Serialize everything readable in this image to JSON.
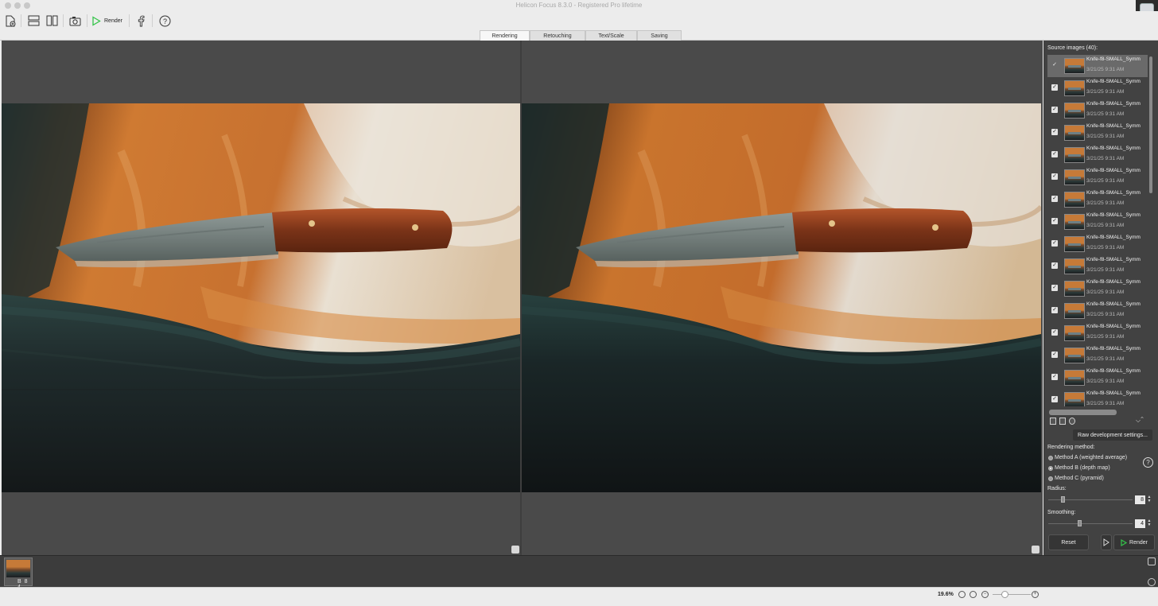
{
  "window": {
    "title": "Helicon Focus 8.3.0 - Registered Pro lifetime"
  },
  "toolbar": {
    "render_label": "Render",
    "icons": [
      "new-file-icon",
      "layout-horizontal-icon",
      "layout-vertical-icon",
      "camera-icon",
      "play-icon",
      "facebook-icon",
      "help-icon"
    ]
  },
  "tabs": [
    {
      "label": "Rendering",
      "active": true
    },
    {
      "label": "Retouching",
      "active": false
    },
    {
      "label": "Text/Scale",
      "active": false
    },
    {
      "label": "Saving",
      "active": false
    }
  ],
  "side": {
    "source_title": "Source images (40):",
    "items": [
      {
        "name": "Knife-f8-SMALL_Symm",
        "date": "3/21/25 9:31 AM",
        "checked": true,
        "selected": true
      },
      {
        "name": "Knife-f8-SMALL_Symm",
        "date": "3/21/25 9:31 AM",
        "checked": true,
        "selected": false
      },
      {
        "name": "Knife-f8-SMALL_Symm",
        "date": "3/21/25 9:31 AM",
        "checked": true,
        "selected": false
      },
      {
        "name": "Knife-f8-SMALL_Symm",
        "date": "3/21/25 9:31 AM",
        "checked": true,
        "selected": false
      },
      {
        "name": "Knife-f8-SMALL_Symm",
        "date": "3/21/25 9:31 AM",
        "checked": true,
        "selected": false
      },
      {
        "name": "Knife-f8-SMALL_Symm",
        "date": "3/21/25 9:31 AM",
        "checked": true,
        "selected": false
      },
      {
        "name": "Knife-f8-SMALL_Symm",
        "date": "3/21/25 9:31 AM",
        "checked": true,
        "selected": false
      },
      {
        "name": "Knife-f8-SMALL_Symm",
        "date": "3/21/25 9:31 AM",
        "checked": true,
        "selected": false
      },
      {
        "name": "Knife-f8-SMALL_Symm",
        "date": "3/21/25 9:31 AM",
        "checked": true,
        "selected": false
      },
      {
        "name": "Knife-f8-SMALL_Symm",
        "date": "3/21/25 9:31 AM",
        "checked": true,
        "selected": false
      },
      {
        "name": "Knife-f8-SMALL_Symm",
        "date": "3/21/25 9:31 AM",
        "checked": true,
        "selected": false
      },
      {
        "name": "Knife-f8-SMALL_Symm",
        "date": "3/21/25 9:31 AM",
        "checked": true,
        "selected": false
      },
      {
        "name": "Knife-f8-SMALL_Symm",
        "date": "3/21/25 9:31 AM",
        "checked": true,
        "selected": false
      },
      {
        "name": "Knife-f8-SMALL_Symm",
        "date": "3/21/25 9:31 AM",
        "checked": true,
        "selected": false
      },
      {
        "name": "Knife-f8-SMALL_Symm",
        "date": "3/21/25 9:31 AM",
        "checked": true,
        "selected": false
      },
      {
        "name": "Knife-f8-SMALL_Symm",
        "date": "3/21/25 9:31 AM",
        "checked": true,
        "selected": false
      }
    ],
    "raw_button": "Raw development settings...",
    "rendering_method_label": "Rendering method:",
    "methods": [
      {
        "label": "Method A (weighted average)",
        "selected": false
      },
      {
        "label": "Method B (depth map)",
        "selected": true
      },
      {
        "label": "Method C (pyramid)",
        "selected": false
      }
    ],
    "radius_label": "Radius:",
    "radius_value": "8",
    "radius_level": 0.15,
    "smoothing_label": "Smoothing:",
    "smoothing_value": "4",
    "smoothing_level": 0.35,
    "reset_label": "Reset",
    "render_label": "Render",
    "help_glyph": "?"
  },
  "filmstrip": {
    "caption": "B 8 4"
  },
  "status": {
    "zoom": "19.6%"
  },
  "colors": {
    "panel_dark": "#424242",
    "viewer_bg": "#4a4a4a",
    "accent_green": "#35c44a"
  }
}
